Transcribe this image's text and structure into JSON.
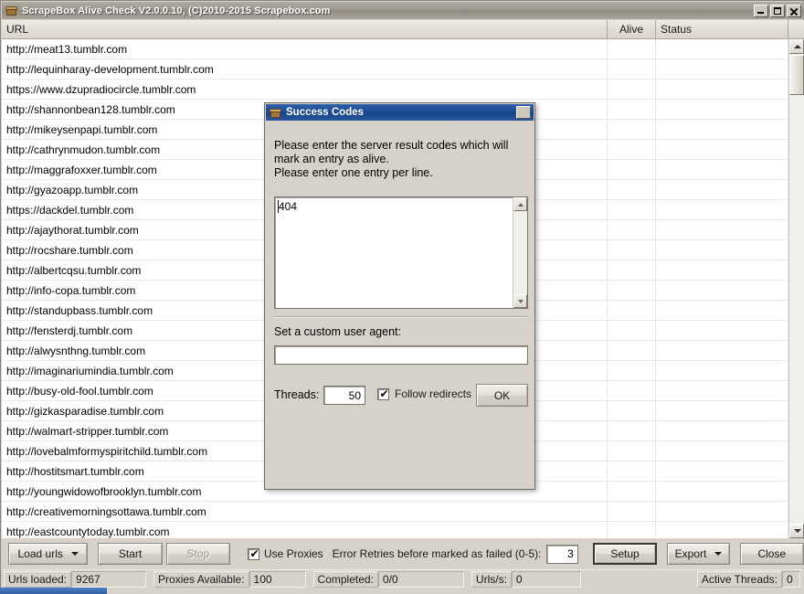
{
  "window": {
    "title": "ScrapeBox Alive Check V2.0.0.10, (C)2010-2015 Scrapebox.com",
    "icon": "box-icon",
    "controls": {
      "minimize": "minimize-icon",
      "maximize": "maximize-icon",
      "close": "close-icon"
    }
  },
  "list": {
    "columns": [
      "URL",
      "Alive",
      "Status"
    ],
    "rows": [
      {
        "url": "http://meat13.tumblr.com",
        "alive": "",
        "status": ""
      },
      {
        "url": "http://lequinharay-development.tumblr.com",
        "alive": "",
        "status": ""
      },
      {
        "url": "https://www.dzupradiocircle.tumblr.com",
        "alive": "",
        "status": ""
      },
      {
        "url": "http://shannonbean128.tumblr.com",
        "alive": "",
        "status": ""
      },
      {
        "url": "http://mikeysenpapi.tumblr.com",
        "alive": "",
        "status": ""
      },
      {
        "url": "http://cathrynmudon.tumblr.com",
        "alive": "",
        "status": ""
      },
      {
        "url": "http://maggrafoxxer.tumblr.com",
        "alive": "",
        "status": ""
      },
      {
        "url": "http://gyazoapp.tumblr.com",
        "alive": "",
        "status": ""
      },
      {
        "url": "https://dackdel.tumblr.com",
        "alive": "",
        "status": ""
      },
      {
        "url": "http://ajaythorat.tumblr.com",
        "alive": "",
        "status": ""
      },
      {
        "url": "http://rocshare.tumblr.com",
        "alive": "",
        "status": ""
      },
      {
        "url": "http://albertcqsu.tumblr.com",
        "alive": "",
        "status": ""
      },
      {
        "url": "http://info-copa.tumblr.com",
        "alive": "",
        "status": ""
      },
      {
        "url": "http://standupbass.tumblr.com",
        "alive": "",
        "status": ""
      },
      {
        "url": "http://fensterdj.tumblr.com",
        "alive": "",
        "status": ""
      },
      {
        "url": "http://alwysnthng.tumblr.com",
        "alive": "",
        "status": ""
      },
      {
        "url": "http://imaginariumindia.tumblr.com",
        "alive": "",
        "status": ""
      },
      {
        "url": "http://busy-old-fool.tumblr.com",
        "alive": "",
        "status": ""
      },
      {
        "url": "http://gizkasparadise.tumblr.com",
        "alive": "",
        "status": ""
      },
      {
        "url": "http://walmart-stripper.tumblr.com",
        "alive": "",
        "status": ""
      },
      {
        "url": "http://lovebalmformyspiritchild.tumblr.com",
        "alive": "",
        "status": ""
      },
      {
        "url": "http://hostitsmart.tumblr.com",
        "alive": "",
        "status": ""
      },
      {
        "url": "http://youngwidowofbrooklyn.tumblr.com",
        "alive": "",
        "status": ""
      },
      {
        "url": "http://creativemorningsottawa.tumblr.com",
        "alive": "",
        "status": ""
      },
      {
        "url": "http://eastcountytoday.tumblr.com",
        "alive": "",
        "status": ""
      }
    ]
  },
  "toolbar": {
    "load_urls": "Load urls",
    "start": "Start",
    "stop": "Stop",
    "use_proxies": "Use Proxies",
    "use_proxies_checked": "✔",
    "error_retries_label": "Error Retries before marked as failed (0-5):",
    "error_retries_value": "3",
    "setup": "Setup",
    "export": "Export",
    "close": "Close"
  },
  "statusbar": {
    "urls_loaded_label": "Urls loaded:",
    "urls_loaded_value": "9267",
    "proxies_label": "Proxies Available:",
    "proxies_value": "100",
    "completed_label": "Completed:",
    "completed_value": "0/0",
    "urls_per_sec_label": "Urls/s:",
    "urls_per_sec_value": "0",
    "active_threads_label": "Active Threads:",
    "active_threads_value": "0"
  },
  "dialog": {
    "title": "Success Codes",
    "icon": "box-icon",
    "close_icon": "close-icon",
    "instructions_line1": "Please enter the server result codes which will",
    "instructions_line2": "mark an entry as alive.",
    "instructions_line3": "Please enter one entry per line.",
    "codes_value": "404",
    "user_agent_label": "Set a custom user agent:",
    "user_agent_value": "",
    "threads_label": "Threads:",
    "threads_value": "50",
    "follow_redirects_label": "Follow redirects",
    "follow_redirects_checked": "✔",
    "ok": "OK"
  },
  "colors": {
    "window_face": "#d6d2c9",
    "dialog_title": "#1e4c96",
    "list_bg": "#ffffff",
    "taskbar_accent": "#2f5fa4"
  }
}
